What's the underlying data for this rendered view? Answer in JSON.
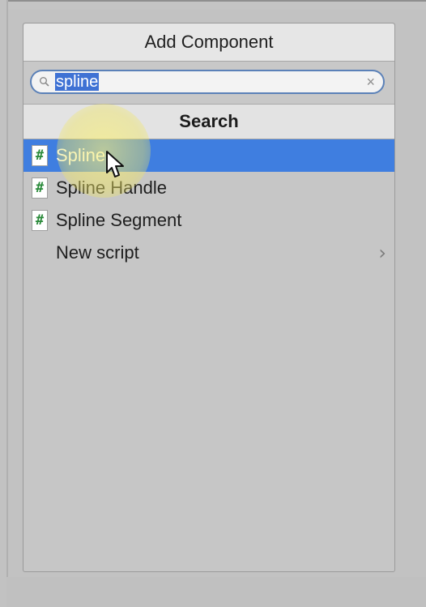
{
  "panel": {
    "title": "Add Component",
    "search": {
      "value": "spline",
      "clear_glyph": "×",
      "icon": "search-icon"
    },
    "section_title": "Search",
    "items": [
      {
        "label": "Spline",
        "icon": "script-hash-icon",
        "selected": true
      },
      {
        "label": "Spline Handle",
        "icon": "script-hash-icon",
        "selected": false
      },
      {
        "label": "Spline Segment",
        "icon": "script-hash-icon",
        "selected": false
      },
      {
        "label": "New script",
        "icon": "",
        "selected": false,
        "has_submenu": true
      }
    ],
    "hash_glyph": "#",
    "submenu_glyph": "›"
  },
  "colors": {
    "selection": "#3f7ee0",
    "search_focus": "#5b81b8",
    "background": "#c2c2c2"
  }
}
